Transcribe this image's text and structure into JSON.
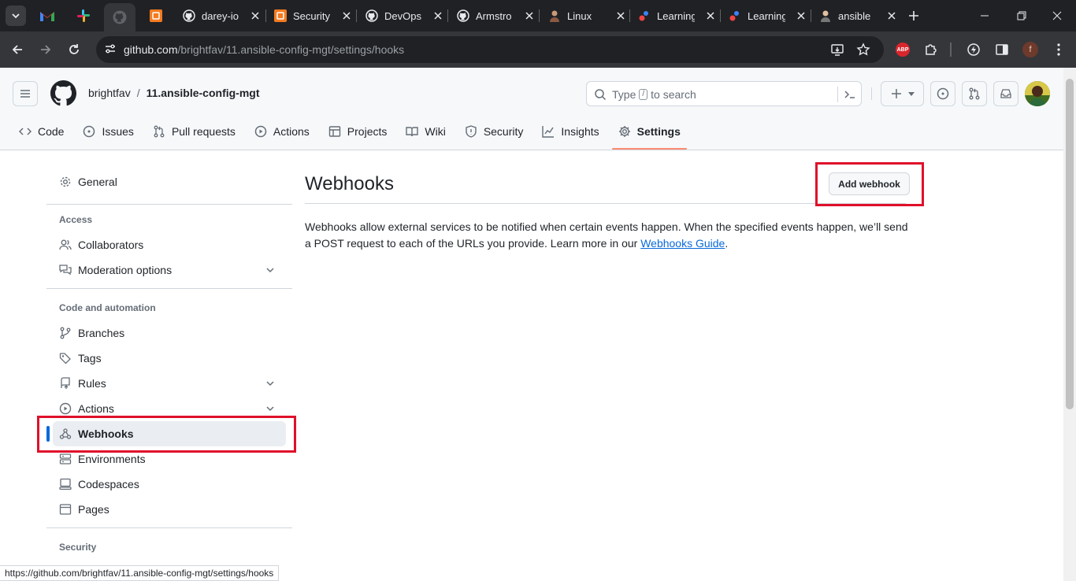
{
  "browser": {
    "tabs": [
      {
        "title": "darey-io"
      },
      {
        "title": "Security"
      },
      {
        "title": "DevOps"
      },
      {
        "title": "Armstro"
      },
      {
        "title": "Linux"
      },
      {
        "title": "Learning"
      },
      {
        "title": "Learning"
      },
      {
        "title": "ansible"
      }
    ],
    "url_host": "github.com",
    "url_path": "/brightfav/11.ansible-config-mgt/settings/hooks",
    "profile_initial": "f",
    "adblock_label": "ABP",
    "status_url": "https://github.com/brightfav/11.ansible-config-mgt/settings/hooks"
  },
  "header": {
    "owner": "brightfav",
    "separator": "/",
    "repo": "11.ansible-config-mgt",
    "search_prefix": "Type",
    "search_key": "/",
    "search_suffix": "to search"
  },
  "repo_nav": [
    {
      "label": "Code"
    },
    {
      "label": "Issues"
    },
    {
      "label": "Pull requests"
    },
    {
      "label": "Actions"
    },
    {
      "label": "Projects"
    },
    {
      "label": "Wiki"
    },
    {
      "label": "Security"
    },
    {
      "label": "Insights"
    },
    {
      "label": "Settings"
    }
  ],
  "sidebar": {
    "general": "General",
    "access_heading": "Access",
    "collaborators": "Collaborators",
    "moderation": "Moderation options",
    "code_heading": "Code and automation",
    "branches": "Branches",
    "tags": "Tags",
    "rules": "Rules",
    "actions": "Actions",
    "webhooks": "Webhooks",
    "environments": "Environments",
    "codespaces": "Codespaces",
    "pages": "Pages",
    "security_heading": "Security"
  },
  "main": {
    "title": "Webhooks",
    "add_button": "Add webhook",
    "desc_text": "Webhooks allow external services to be notified when certain events happen. When the specified events happen, we’ll send a POST request to each of the URLs you provide. Learn more in our ",
    "desc_link": "Webhooks Guide",
    "desc_end": "."
  },
  "colors": {
    "highlight": "#e0102a",
    "accent": "#0969da",
    "selected_tab_underline": "#fd8c73"
  }
}
